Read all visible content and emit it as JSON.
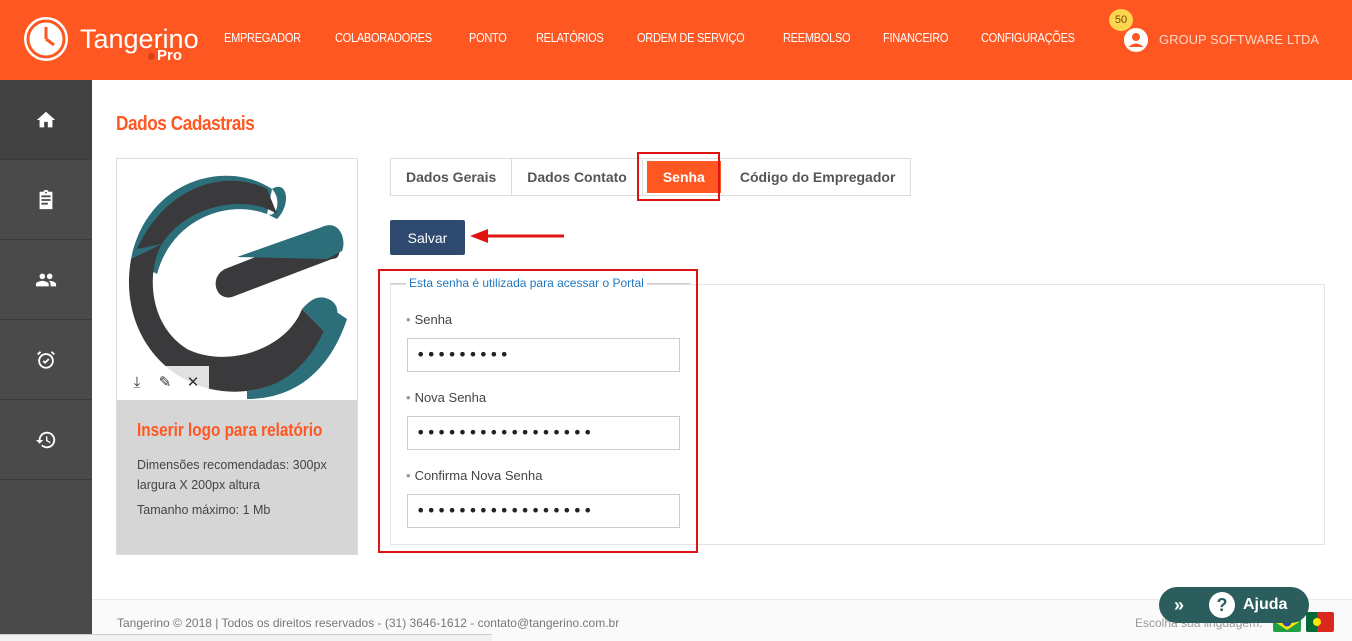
{
  "header": {
    "brand": "Tangerino",
    "brand_sub": "Pro",
    "nav": [
      "EMPREGADOR",
      "COLABORADORES",
      "PONTO",
      "RELATÓRIOS",
      "ORDEM DE SERVIÇO",
      "REEMBOLSO",
      "FINANCEIRO",
      "CONFIGURAÇÕES"
    ],
    "notification_count": "50",
    "company": "GROUP SOFTWARE LTDA"
  },
  "sidebar": {
    "items": [
      {
        "icon": "home-icon"
      },
      {
        "icon": "clipboard-icon"
      },
      {
        "icon": "people-icon"
      },
      {
        "icon": "alarm-icon"
      },
      {
        "icon": "history-icon"
      }
    ]
  },
  "page": {
    "title": "Dados Cadastrais"
  },
  "logo_card": {
    "title": "Inserir logo para relatório",
    "dimensions": "Dimensões recomendadas: 300px largura X 200px altura",
    "max_size": "Tamanho máximo: 1 Mb"
  },
  "tabs": {
    "items": [
      "Dados Gerais",
      "Dados Contato",
      "Senha",
      "Código do Empregador"
    ],
    "active": "Senha"
  },
  "form": {
    "save_label": "Salvar",
    "legend": "Esta senha é utilizada para acessar o Portal",
    "fields": [
      {
        "label": "Senha",
        "value": "•••••••••"
      },
      {
        "label": "Nova Senha",
        "value": "•••••••••••••••••"
      },
      {
        "label": "Confirma Nova Senha",
        "value": "•••••••••••••••••"
      }
    ]
  },
  "footer": {
    "copyright": "Tangerino © 2018 | Todos os direitos reservados - (31) 3646-1612 - contato@tangerino.com.br",
    "language_label": "Escolha sua linguagem:"
  },
  "help": {
    "label": "Ajuda"
  },
  "colors": {
    "accent": "#ff5722",
    "save_button": "#2e4a6e",
    "highlight": "#e01313",
    "help": "#2b5d5d"
  }
}
